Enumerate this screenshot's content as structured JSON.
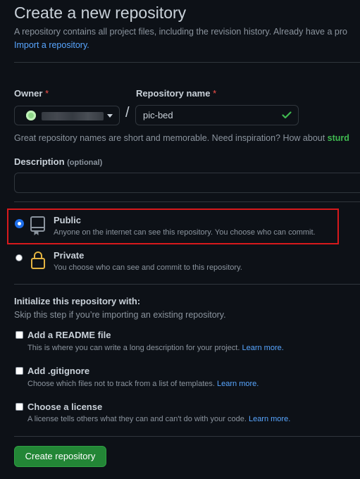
{
  "header": {
    "title": "Create a new repository",
    "subtitle": "A repository contains all project files, including the revision history. Already have a pro",
    "import_link": "Import a repository."
  },
  "owner": {
    "label": "Owner",
    "required_mark": "*",
    "avatar_icon": "owner-avatar",
    "dropdown_icon": "chevron-down-icon"
  },
  "repo_name": {
    "label": "Repository name",
    "required_mark": "*",
    "value": "pic-bed",
    "valid_icon": "check-icon"
  },
  "slash": "/",
  "name_hint": {
    "text": "Great repository names are short and memorable. Need inspiration? How about ",
    "suggestion": "sturd"
  },
  "description": {
    "label": "Description",
    "optional": "(optional)",
    "value": ""
  },
  "visibility": {
    "selected": "public",
    "options": [
      {
        "title": "Public",
        "desc": "Anyone on the internet can see this repository. You choose who can commit.",
        "icon": "repo-icon"
      },
      {
        "title": "Private",
        "desc": "You choose who can see and commit to this repository.",
        "icon": "lock-icon"
      }
    ]
  },
  "initialize": {
    "title": "Initialize this repository with:",
    "subtitle": "Skip this step if you’re importing an existing repository.",
    "options": [
      {
        "title": "Add a README file",
        "desc": "This is where you can write a long description for your project.",
        "link": "Learn more.",
        "checked": false
      },
      {
        "title": "Add .gitignore",
        "desc": "Choose which files not to track from a list of templates.",
        "link": "Learn more.",
        "checked": false
      },
      {
        "title": "Choose a license",
        "desc": "A license tells others what they can and can't do with your code.",
        "link": "Learn more.",
        "checked": false
      }
    ]
  },
  "submit": {
    "label": "Create repository"
  },
  "colors": {
    "background": "#0d1117",
    "primary_button": "#238636",
    "link": "#58a6ff",
    "valid_green": "#3fb950",
    "highlight_box": "#d7191c"
  }
}
